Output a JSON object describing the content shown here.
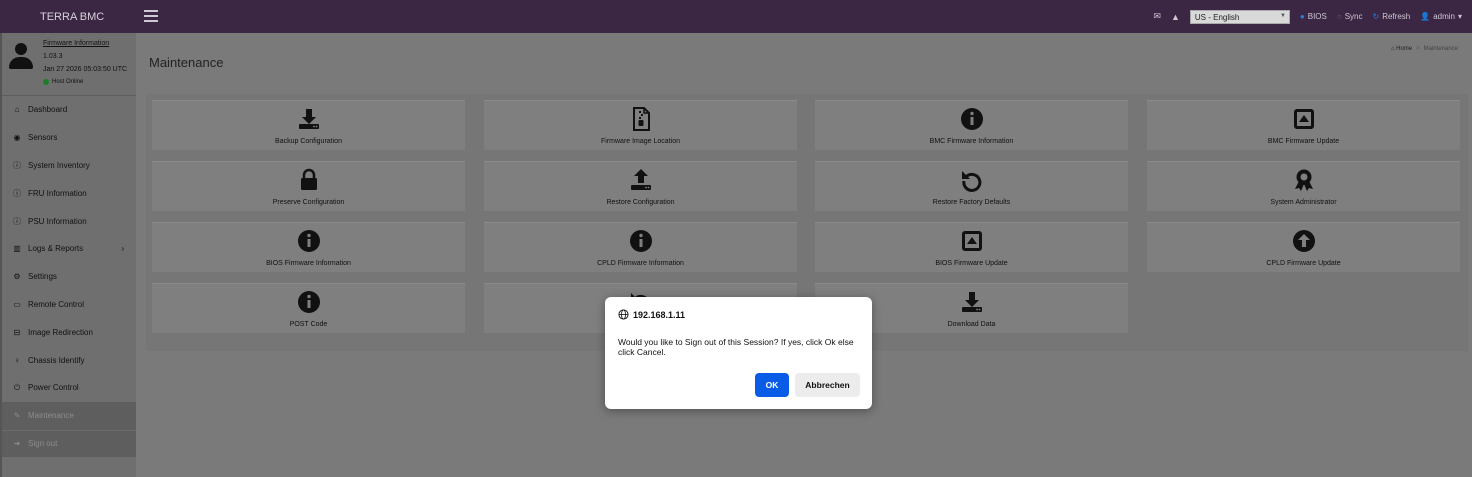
{
  "header": {
    "brand": "TERRA BMC",
    "language": "US - English",
    "bios": "BIOS",
    "sync": "Sync",
    "refresh": "Refresh",
    "user": "admin"
  },
  "profile": {
    "link": "Firmware Information",
    "version": "1.03.3",
    "date": "Jan 27 2026 05:03:50 UTC",
    "status": "Host Online"
  },
  "sidebar": {
    "items": [
      {
        "label": "Dashboard",
        "icon": "dashboard-icon"
      },
      {
        "label": "Sensors",
        "icon": "sensors-icon"
      },
      {
        "label": "System Inventory",
        "icon": "info-icon"
      },
      {
        "label": "FRU Information",
        "icon": "info-icon"
      },
      {
        "label": "PSU Information",
        "icon": "info-icon"
      },
      {
        "label": "Logs & Reports",
        "icon": "chart-icon"
      },
      {
        "label": "Settings",
        "icon": "gear-icon"
      },
      {
        "label": "Remote Control",
        "icon": "monitor-icon"
      },
      {
        "label": "Image Redirection",
        "icon": "disk-icon"
      },
      {
        "label": "Chassis Identify",
        "icon": "bulb-icon"
      },
      {
        "label": "Power Control",
        "icon": "power-icon"
      },
      {
        "label": "Maintenance",
        "icon": "wrench-icon"
      },
      {
        "label": "Sign out",
        "icon": "signout-icon"
      }
    ]
  },
  "main": {
    "title": "Maintenance",
    "breadcrumb_home": "Home",
    "breadcrumb_current": "Maintenance",
    "tiles": [
      {
        "label": "Backup Configuration",
        "icon": "download-icon"
      },
      {
        "label": "Firmware Image Location",
        "icon": "file-zip-icon"
      },
      {
        "label": "BMC Firmware Information",
        "icon": "info-icon"
      },
      {
        "label": "BMC Firmware Update",
        "icon": "eject-icon"
      },
      {
        "label": "Preserve Configuration",
        "icon": "lock-icon"
      },
      {
        "label": "Restore Configuration",
        "icon": "upload-icon"
      },
      {
        "label": "Restore Factory Defaults",
        "icon": "undo-icon"
      },
      {
        "label": "System Administrator",
        "icon": "award-icon"
      },
      {
        "label": "BIOS Firmware Information",
        "icon": "info-icon"
      },
      {
        "label": "CPLD Firmware Information",
        "icon": "info-icon"
      },
      {
        "label": "BIOS Firmware Update",
        "icon": "eject-icon"
      },
      {
        "label": "CPLD Firmware Update",
        "icon": "arrow-up-circle-icon"
      },
      {
        "label": "POST Code",
        "icon": "info-icon"
      },
      {
        "label": "",
        "icon": "undo-icon"
      },
      {
        "label": "Download Data",
        "icon": "download-icon"
      }
    ]
  },
  "dialog": {
    "host": "192.168.1.11",
    "message": "Would you like to Sign out of this Session? If yes, click Ok else click Cancel.",
    "ok": "OK",
    "cancel": "Abbrechen"
  }
}
